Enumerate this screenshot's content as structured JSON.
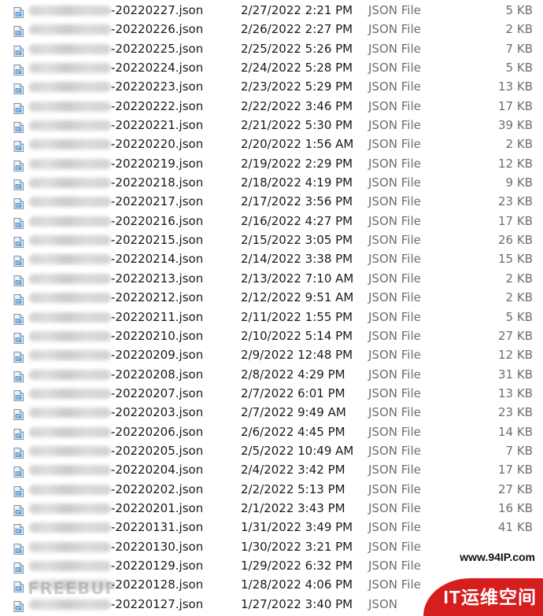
{
  "files": [
    {
      "name": "-20220227.json",
      "modified": "2/27/2022 2:21 PM",
      "type": "JSON File",
      "size": "5 KB"
    },
    {
      "name": "-20220226.json",
      "modified": "2/26/2022 2:27 PM",
      "type": "JSON File",
      "size": "2 KB"
    },
    {
      "name": "-20220225.json",
      "modified": "2/25/2022 5:26 PM",
      "type": "JSON File",
      "size": "7 KB"
    },
    {
      "name": "-20220224.json",
      "modified": "2/24/2022 5:28 PM",
      "type": "JSON File",
      "size": "5 KB"
    },
    {
      "name": "-20220223.json",
      "modified": "2/23/2022 5:29 PM",
      "type": "JSON File",
      "size": "13 KB"
    },
    {
      "name": "-20220222.json",
      "modified": "2/22/2022 3:46 PM",
      "type": "JSON File",
      "size": "17 KB"
    },
    {
      "name": "-20220221.json",
      "modified": "2/21/2022 5:30 PM",
      "type": "JSON File",
      "size": "39 KB"
    },
    {
      "name": "-20220220.json",
      "modified": "2/20/2022 1:56 AM",
      "type": "JSON File",
      "size": "2 KB"
    },
    {
      "name": "-20220219.json",
      "modified": "2/19/2022 2:29 PM",
      "type": "JSON File",
      "size": "12 KB"
    },
    {
      "name": "-20220218.json",
      "modified": "2/18/2022 4:19 PM",
      "type": "JSON File",
      "size": "9 KB"
    },
    {
      "name": "-20220217.json",
      "modified": "2/17/2022 3:56 PM",
      "type": "JSON File",
      "size": "23 KB"
    },
    {
      "name": "-20220216.json",
      "modified": "2/16/2022 4:27 PM",
      "type": "JSON File",
      "size": "17 KB"
    },
    {
      "name": "-20220215.json",
      "modified": "2/15/2022 3:05 PM",
      "type": "JSON File",
      "size": "26 KB"
    },
    {
      "name": "-20220214.json",
      "modified": "2/14/2022 3:38 PM",
      "type": "JSON File",
      "size": "15 KB"
    },
    {
      "name": "-20220213.json",
      "modified": "2/13/2022 7:10 AM",
      "type": "JSON File",
      "size": "2 KB"
    },
    {
      "name": "-20220212.json",
      "modified": "2/12/2022 9:51 AM",
      "type": "JSON File",
      "size": "2 KB"
    },
    {
      "name": "-20220211.json",
      "modified": "2/11/2022 1:55 PM",
      "type": "JSON File",
      "size": "5 KB"
    },
    {
      "name": "-20220210.json",
      "modified": "2/10/2022 5:14 PM",
      "type": "JSON File",
      "size": "27 KB"
    },
    {
      "name": "-20220209.json",
      "modified": "2/9/2022 12:48 PM",
      "type": "JSON File",
      "size": "12 KB"
    },
    {
      "name": "-20220208.json",
      "modified": "2/8/2022 4:29 PM",
      "type": "JSON File",
      "size": "31 KB"
    },
    {
      "name": "-20220207.json",
      "modified": "2/7/2022 6:01 PM",
      "type": "JSON File",
      "size": "13 KB"
    },
    {
      "name": "-20220203.json",
      "modified": "2/7/2022 9:49 AM",
      "type": "JSON File",
      "size": "23 KB"
    },
    {
      "name": "-20220206.json",
      "modified": "2/6/2022 4:45 PM",
      "type": "JSON File",
      "size": "14 KB"
    },
    {
      "name": "-20220205.json",
      "modified": "2/5/2022 10:49 AM",
      "type": "JSON File",
      "size": "7 KB"
    },
    {
      "name": "-20220204.json",
      "modified": "2/4/2022 3:42 PM",
      "type": "JSON File",
      "size": "17 KB"
    },
    {
      "name": "-20220202.json",
      "modified": "2/2/2022 5:13 PM",
      "type": "JSON File",
      "size": "27 KB"
    },
    {
      "name": "-20220201.json",
      "modified": "2/1/2022 3:43 PM",
      "type": "JSON File",
      "size": "16 KB"
    },
    {
      "name": "-20220131.json",
      "modified": "1/31/2022 3:49 PM",
      "type": "JSON File",
      "size": "41 KB"
    },
    {
      "name": "-20220130.json",
      "modified": "1/30/2022 3:21 PM",
      "type": "JSON File",
      "size": ""
    },
    {
      "name": "-20220129.json",
      "modified": "1/29/2022 6:32 PM",
      "type": "JSON File",
      "size": ""
    },
    {
      "name": "-20220128.json",
      "modified": "1/28/2022 4:06 PM",
      "type": "JSON File",
      "size": ""
    },
    {
      "name": "-20220127.json",
      "modified": "1/27/2022 3:40 PM",
      "type": "JSON",
      "size": ""
    }
  ],
  "icon": "json-file-icon",
  "watermark": {
    "left_text": "FREEBUF",
    "site": "www.94IP.com",
    "badge": "IT运维空间",
    "badge_color": "#d71e1e"
  }
}
